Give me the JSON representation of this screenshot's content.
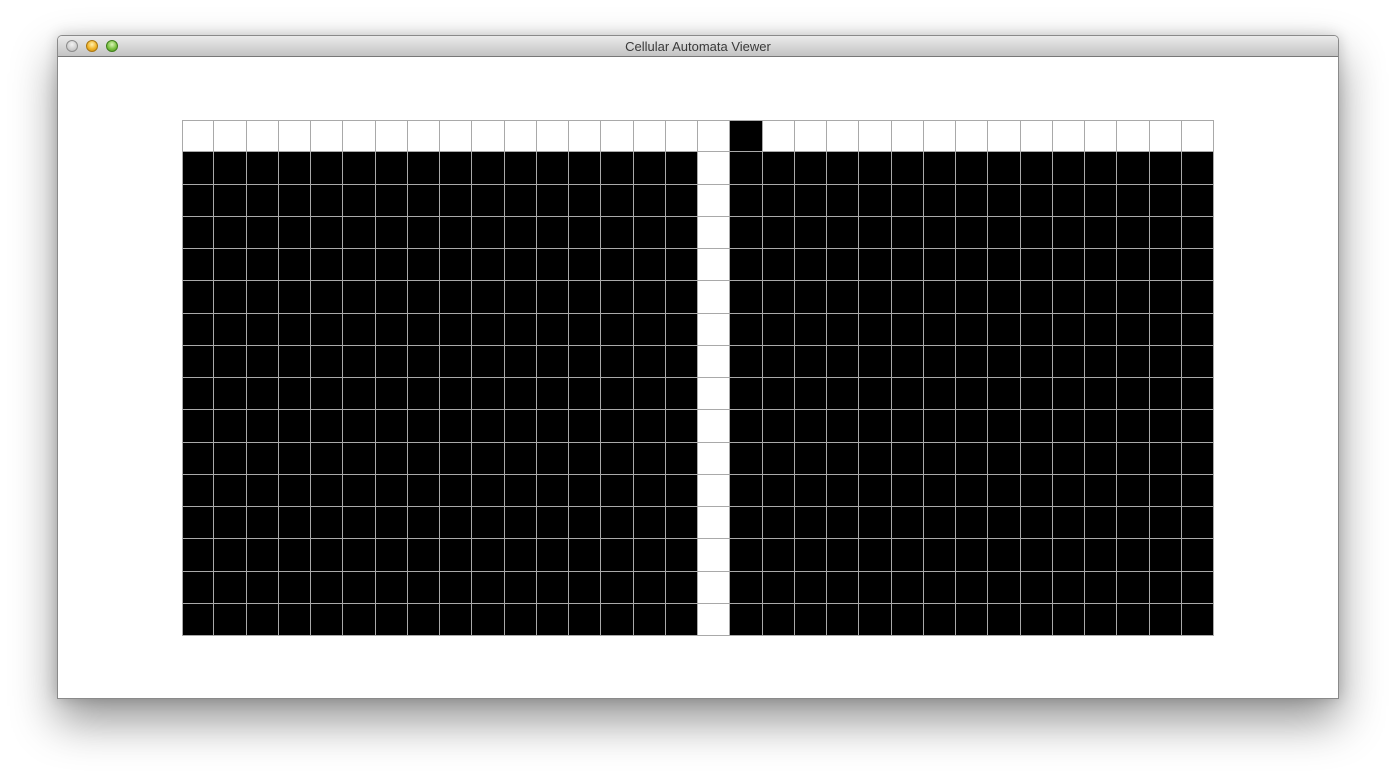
{
  "window": {
    "title": "Cellular Automata Viewer"
  },
  "colors": {
    "alive": "#000000",
    "dead": "#ffffff",
    "gridline": "#a9a9a9"
  },
  "automaton": {
    "columns": 32,
    "rows": 16,
    "cells": [
      "00000000000000000100000000000000",
      "11111111111111110111111111111111",
      "11111111111111110111111111111111",
      "11111111111111110111111111111111",
      "11111111111111110111111111111111",
      "11111111111111110111111111111111",
      "11111111111111110111111111111111",
      "11111111111111110111111111111111",
      "11111111111111110111111111111111",
      "11111111111111110111111111111111",
      "11111111111111110111111111111111",
      "11111111111111110111111111111111",
      "11111111111111110111111111111111",
      "11111111111111110111111111111111",
      "11111111111111110111111111111111",
      "11111111111111110111111111111111"
    ]
  }
}
